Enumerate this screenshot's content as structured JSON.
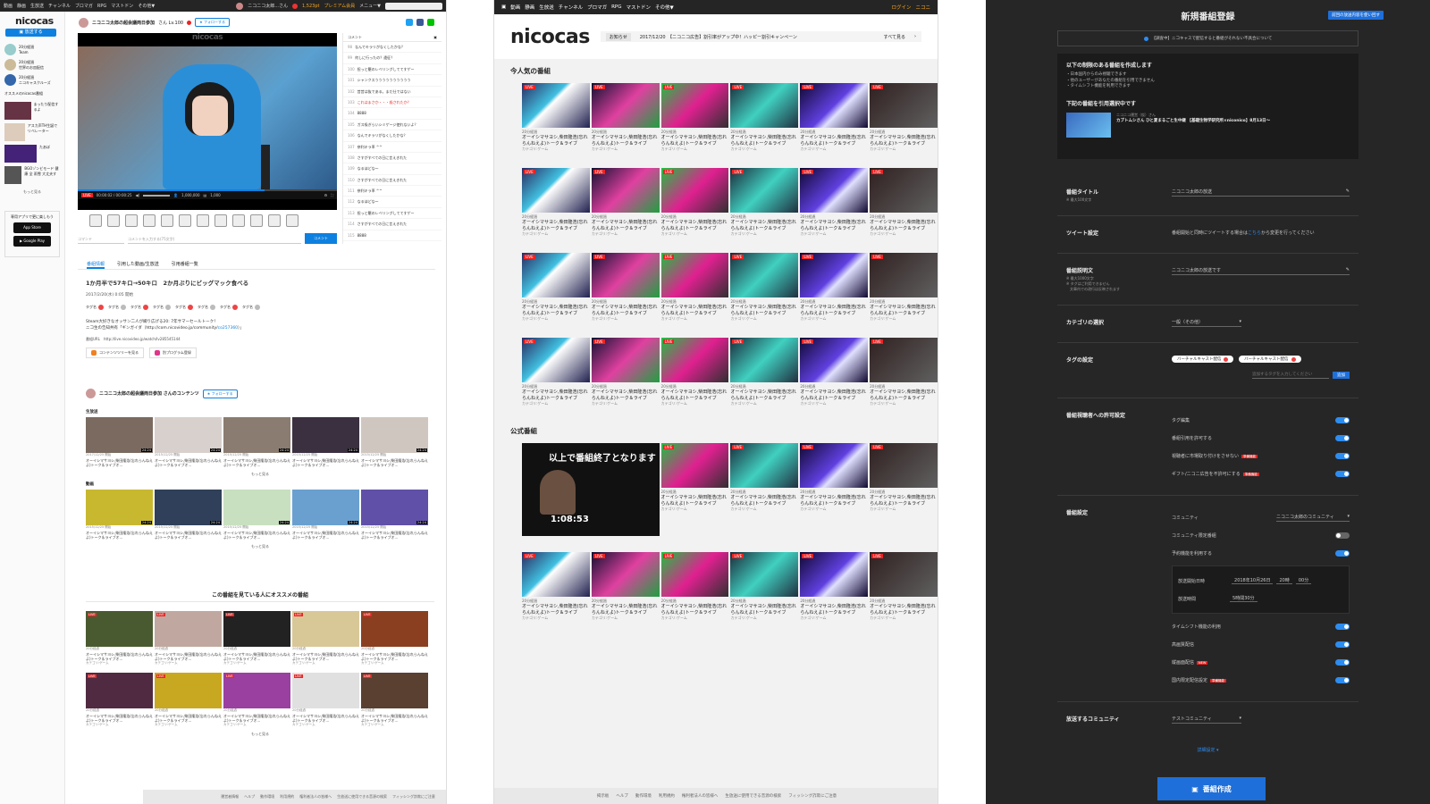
{
  "p1": {
    "topbar": {
      "items": [
        "動画",
        "静画",
        "生放送",
        "チャンネル",
        "ブロマガ",
        "RPG",
        "マストドン",
        "その他▼"
      ],
      "user": "ニコニコ太郎...さん",
      "points": "1,523pt",
      "premium": "プレミアム会員",
      "menu": "メニュー▼"
    },
    "logo": "nicocas",
    "broadcast_btn": "放送する",
    "follows": [
      {
        "name": "20分経過",
        "sub": "Team"
      },
      {
        "name": "20分経過",
        "sub": "世界のお皿配信"
      },
      {
        "name": "20分経過",
        "sub": "ニコキャスクルーズ"
      }
    ],
    "rec_header": "オススメのnicocas番組",
    "recs": [
      "まったり配信するよ",
      "アスカ声TH生誕でリベレーター",
      "たあぼ",
      "BGOゾンビモード 健康 全 雨雪 大丈夫す"
    ],
    "more": "もっと見る",
    "app_title": "専用アプリで更に楽しもう",
    "app_store": "App Store",
    "google_play": "Google Play",
    "channel_title": "ニコニコ太郎の超会議両日参加",
    "channel_level": "さん Lv.100",
    "follow": "★ フォローする",
    "player_logo": "nicocas",
    "time": "00:00:02 / 00:00:25",
    "viewers": "1,000,000",
    "comment_count": "1,000",
    "progress": 0.72,
    "comment_header": "コメント",
    "comments": [
      {
        "n": "98",
        "t": "なんでキラリがなくしたかな？"
      },
      {
        "n": "99",
        "t": "何しに行ったの？遠征？"
      },
      {
        "n": "100",
        "t": "担っと籠のレベリングしててすゲー"
      },
      {
        "n": "101",
        "t": "シャンクスうううううううううう"
      },
      {
        "n": "102",
        "t": "昔昔は抜である。まだ仕ではない"
      },
      {
        "n": "103",
        "t": "これはまさか・・・殺されたか？"
      },
      {
        "n": "104",
        "t": "8888"
      },
      {
        "n": "105",
        "t": "ガス吸ぎらいシミゲージ使れないよ？"
      },
      {
        "n": "106",
        "t": "なんでキラリがなくしたかな？"
      },
      {
        "n": "107",
        "t": "奈利キラ率 ^^"
      },
      {
        "n": "108",
        "t": "さすがすべての日に言えきれた"
      },
      {
        "n": "109",
        "t": "なるほどな～"
      },
      {
        "n": "110",
        "t": "さすがすべての日に言えきれた"
      },
      {
        "n": "111",
        "t": "奈利キラ率 ^^"
      },
      {
        "n": "112",
        "t": "なるほどな～"
      },
      {
        "n": "113",
        "t": "担っと籠のレベリングしててすゲー"
      },
      {
        "n": "114",
        "t": "さすがすべての日に言えきれた"
      },
      {
        "n": "115",
        "t": "8888"
      }
    ],
    "input_cmd": "コマンド",
    "input_ph": "コメントを入力する(75文字)",
    "comment_btn": "コメント",
    "tabs": [
      "番組情報",
      "引用した動画/生放送",
      "引用番組一覧"
    ],
    "program_title": "1か月半で57キロ→50キロ　2か月ぶりにビッグマック食べる",
    "program_date": "2017/2/20(水) 0:05 開始",
    "tags": [
      "タグ名",
      "タグ名",
      "タグ名",
      "タグ名",
      "タグ名",
      "タグ名",
      "タグ名",
      "タグ名"
    ],
    "desc1": "Steam大好きなオッサン二人が織り広げる20: 7年サマーセールトーク！",
    "desc2": "ニコ生の告知共有「ギンガイダ（http://com.nicovideo.jp/community/",
    "desc2_link": "co257360",
    "desc2_end": "）」",
    "url_label": "番組URL",
    "url": "http://live.nicovideo.jp/watch/lv285545144",
    "link1": "コンテンツツリーを見る",
    "link2": "別プログラム登録",
    "user_content_title": "ニコニコ太郎の超会議両日参加 さんのコンテンツ",
    "live_label": "生放送",
    "video_label": "動画",
    "thumb_date": "2015/12/25 開始",
    "thumb_date2": "2017/12/25 開始",
    "thumb_title": "オーイシマサヨシ,柴田隆浩(忘れらんねえよ)トーク＆ライブオ...",
    "dur": "24:24",
    "recommend_title": "この番組を見ている人にオススメの番組",
    "ago": "20分経過",
    "cat": "カテゴリ:ゲーム",
    "footer": [
      "運営者情報",
      "ヘルプ",
      "動作環境",
      "利用規約",
      "権利者法人の皆様へ",
      "生放送に使用できる音源の検索",
      "フィッシング詐欺にご注意"
    ]
  },
  "p2": {
    "topbar": [
      "動画",
      "静画",
      "生放送",
      "チャンネル",
      "ブロマガ",
      "RPG",
      "マストドン",
      "その他▼"
    ],
    "login": "ログイン",
    "niconico": "ニコニ",
    "logo": "nicocas",
    "news_tag": "お知らせ",
    "news_text": "2017/12/20　【ニコニコ広告】割引率がアップ中！ハッピー割引キャンペーン",
    "news_all": "すべて見る",
    "popular": "今人気の番組",
    "official": "公式番組",
    "ago": "20分経過",
    "title": "オーイシマサヨシ,柴田隆浩(忘れらんねえよ)トーク＆ライブ",
    "cat": "カテゴリ:ゲーム",
    "big_text1": "以上で番組終了となります",
    "big_timer": "1:08:53",
    "footer": [
      "掲示板",
      "ヘルプ",
      "動作環境",
      "利用規約",
      "権利者法人の皆様へ",
      "生放送に使用できる音源の検索",
      "フィッシング詐欺にご注意"
    ]
  },
  "p3": {
    "title": "新規番組登録",
    "reuse_btn": "前回の放送内容を使い回す",
    "notice": "【調査中】ニコキャスで配信すると番組がそれない不具合について",
    "restr_title": "以下の制限のある番組を作成します",
    "restr_items": [
      "・日本国内からのみ視聴できます",
      "・他のユーザーがあなたの番組を引用できません",
      "・タイムシフト機能を利用できます"
    ],
    "quote_title": "下記の番組を引用選択中です",
    "quote_user": "ニコニコ運営（仮）さん",
    "quote_prog": "カブトムシさん ひと夏まるごと生中継 【基礎生物学研究所×niconico】8月13日〜",
    "prog_title_label": "番組タイトル",
    "prog_title_hint": "※ 最大100文字",
    "prog_title_val": "ニコニコ太郎の放送",
    "tweet_label": "ツイート設定",
    "tweet_text": "番組開始と同時にツイートする場合は",
    "tweet_link": "こちら",
    "tweet_text2": "から変更を行ってください",
    "desc_label": "番組説明文",
    "desc_hints": [
      "※ 最大1000文字",
      "※ タグはご利用できません",
      "　文章内での改行は反映されます"
    ],
    "desc_val": "ニコニコ太郎の放送です",
    "cat_label": "カテゴリの選択",
    "cat_val": "一般（その他）",
    "tag_label": "タグの設定",
    "tags": [
      "バーチャルキャスト配信",
      "バーチャルキャスト配信"
    ],
    "tag_ph": "追加するタグを入力してください",
    "tag_add": "追加",
    "perm_label": "番組視聴者への許可設定",
    "perms": [
      {
        "t": "タグ編集",
        "on": true,
        "badge": ""
      },
      {
        "t": "番組引用を許可する",
        "on": true,
        "badge": ""
      },
      {
        "t": "視聴者に市場取り付けをさせない",
        "on": true,
        "badge": "準備機能"
      },
      {
        "t": "ギフト/ニコニ広告を不許可にする",
        "on": true,
        "badge": "準備機能"
      }
    ],
    "prog_set_label": "番組設定",
    "community_label": "コミュニティ",
    "community_val": "ニコニコ太郎のコミュニティ",
    "settings": [
      {
        "t": "コミュニティ限定番組",
        "on": false,
        "badge": ""
      },
      {
        "t": "予約機能を利用する",
        "on": true,
        "badge": ""
      }
    ],
    "start_label": "放送開始日時",
    "start_date": "2018年10月26日",
    "start_hour": "20時",
    "start_min": "00分",
    "dur_label": "放送時間",
    "dur_val": "5時間30分",
    "settings2": [
      {
        "t": "タイムシフト機能の利用",
        "on": true,
        "badge": ""
      },
      {
        "t": "高画質配信",
        "on": true,
        "badge": ""
      },
      {
        "t": "縦画面配信",
        "on": true,
        "badge": "NEW"
      },
      {
        "t": "国内限定配信設定",
        "on": true,
        "badge": "準備機能"
      }
    ],
    "bcast_comm_label": "放送するコミュニティ",
    "bcast_comm_val": "テストコミュニティ",
    "detail": "詳細設定 ▾",
    "create": "番組作成"
  },
  "colors": {
    "accent": "#0e80e0",
    "live": "#e22222",
    "dark": "#262626"
  }
}
